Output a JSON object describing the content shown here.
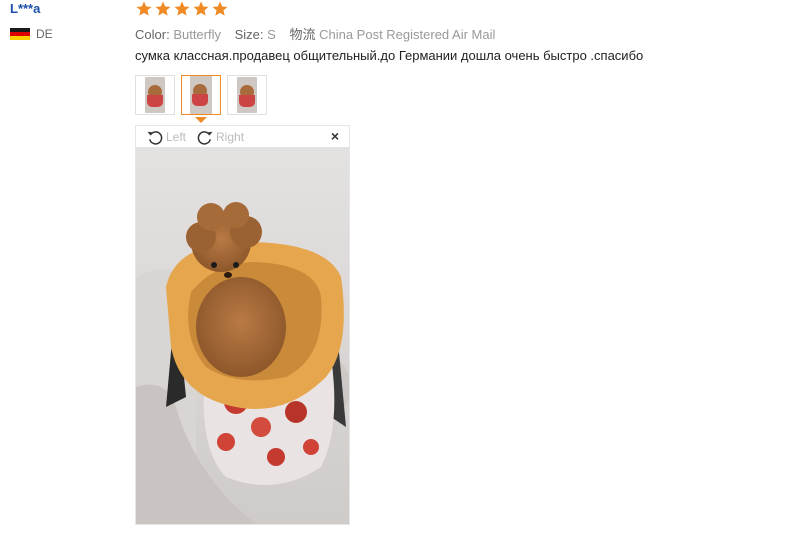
{
  "reviewer": {
    "name": "L***a",
    "country": "DE"
  },
  "rating": {
    "stars": 5,
    "max": 5,
    "color": "#f08a24"
  },
  "order": {
    "color_label": "Color:",
    "color_value": "Butterfly",
    "size_label": "Size:",
    "size_value": "S",
    "shipping_label": "物流",
    "shipping_value": "China Post Registered Air Mail"
  },
  "review": {
    "text": "сумка классная.продавец общительный.до Германии дошла очень быстро .спасибо"
  },
  "thumbnails": {
    "count": 3,
    "active_index": 1
  },
  "viewer": {
    "rotate_left_label": "Left",
    "rotate_right_label": "Right",
    "close_label": "×"
  },
  "colors": {
    "accent": "#f08a24",
    "link": "#1b4fa8"
  }
}
